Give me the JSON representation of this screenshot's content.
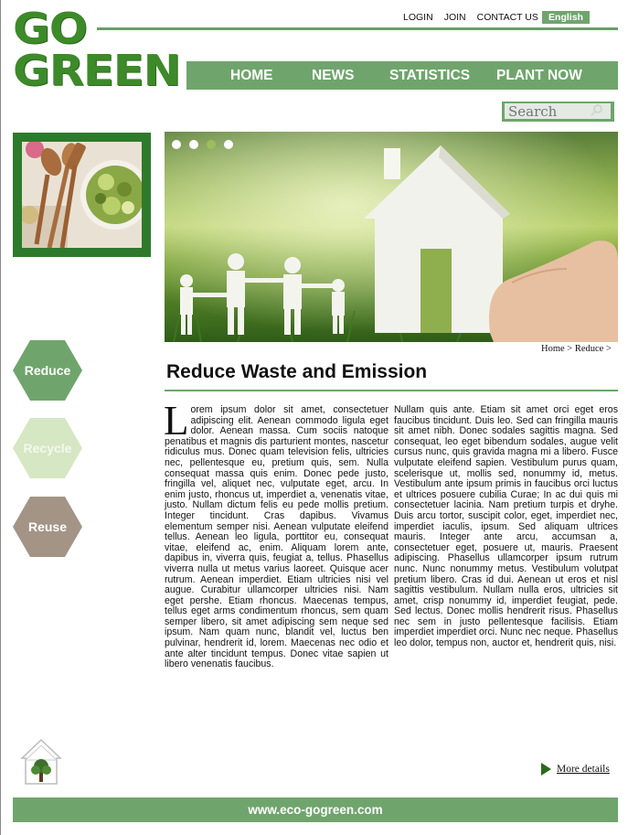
{
  "logo": {
    "line1": "GO",
    "line2": "GREEN"
  },
  "toplinks": {
    "login": "LOGIN",
    "join": "JOIN",
    "contact": "CONTACT US",
    "language": "English"
  },
  "nav": [
    "HOME",
    "NEWS",
    "STATISTICS",
    "PLANT NOW"
  ],
  "search": {
    "placeholder": "Search"
  },
  "breadcrumb": "Home > Reduce >",
  "hex_buttons": {
    "reduce": "Reduce",
    "recycle": "Recycle",
    "reuse": "Reuse"
  },
  "colors": {
    "accent": "#6fa56c",
    "dark_green": "#2e7a2c",
    "reduce": "#6fa56c",
    "recycle": "#d6e7c3",
    "reuse": "#a39486"
  },
  "article": {
    "title": "Reduce Waste and Emission",
    "dropcap": "L",
    "col1": "orem ipsum dolor sit amet, consectetuer adipiscing elit. Aenean commodo ligula eget dolor. Aenean massa. Cum sociis natoque penatibus et magnis dis parturient montes, nascetur ridiculus mus. Donec quam television felis, ultricies nec, pellentesque eu, pretium quis, sem. Nulla consequat massa quis enim. Donec pede justo, fringilla vel, aliquet nec, vulputate eget, arcu. In enim justo, rhoncus ut, imperdiet a, venenatis vitae, justo. Nullam dictum felis eu pede mollis pretium. Integer tincidunt. Cras dapibus. Vivamus elementum semper nisi. Aenean vulputate eleifend tellus. Aenean leo ligula, porttitor eu, consequat vitae, eleifend ac, enim. Aliquam lorem ante, dapibus in, viverra quis, feugiat a, tellus. Phasellus viverra nulla ut metus varius laoreet. Quisque acer rutrum. Aenean imperdiet. Etiam ultricies nisi vel augue. Curabitur ullamcorper ultricies nisi. Nam eget pershe. Etiam rhoncus. Maecenas tempus, tellus eget arms condimentum rhoncus, sem quam semper libero, sit amet adipiscing sem neque sed ipsum. Nam quam nunc, blandit vel, luctus ben pulvinar, hendrerit id, lorem. Maecenas nec odio et ante alter tincidunt tempus. Donec vitae sapien ut libero venenatis faucibus.",
    "col2": "Nullam quis ante. Etiam sit amet orci eget eros faucibus tincidunt. Duis leo. Sed can fringilla mauris sit amet nibh. Donec sodales sagittis magna. Sed consequat, leo eget bibendum sodales, augue velit cursus nunc, quis gravida magna mi a libero. Fusce vulputate eleifend sapien. Vestibulum purus quam, scelerisque ut, mollis sed, nonummy id, metus. Vestibulum ante ipsum primis in faucibus orci luctus et ultrices posuere cubilia Curae; In ac dui quis mi consectetuer lacinia. Nam pretium turpis et dryhe. Duis arcu tortor, suscipit color, eget, imperdiet nec, imperdiet iaculis, ipsum. Sed aliquam ultrices mauris. Integer ante arcu, accumsan a, consectetuer eget, posuere ut, mauris. Praesent adipiscing. Phasellus ullamcorper ipsum rutrum nunc. Nunc nonummy metus. Vestibulum volutpat pretium libero. Cras id dui. Aenean ut eros et nisl sagittis vestibulum. Nullam nulla eros, ultricies sit amet, crisp nonummy id, imperdiet feugiat, pede. Sed lectus. Donec mollis hendrerit risus. Phasellus nec sem in justo pellentesque facilisis. Etiam imperdiet imperdiet orci. Nunc nec neque. Phasellus leo dolor, tempus non, auctor et, hendrerit quis, nisi."
  },
  "more_details": "More details",
  "footer": "www.eco-gogreen.com",
  "icons": [
    "search-icon",
    "slider-dots",
    "house-tree-icon",
    "play-triangle-icon"
  ]
}
